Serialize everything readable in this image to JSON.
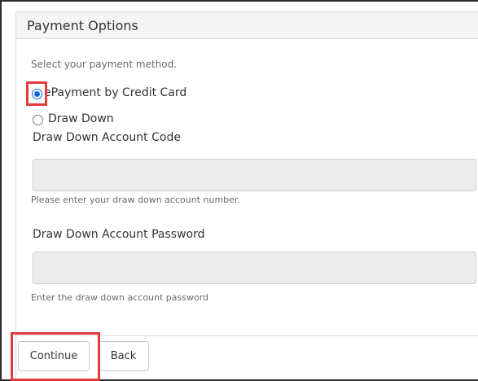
{
  "panel": {
    "title": "Payment Options",
    "instruction": "Select your payment method."
  },
  "payment_methods": [
    {
      "label": "ePayment by Credit Card",
      "selected": true
    },
    {
      "label": "Draw Down",
      "selected": false
    }
  ],
  "fields": {
    "account_code": {
      "label": "Draw Down Account Code",
      "value": "",
      "help": "Please enter your draw down account number."
    },
    "account_password": {
      "label": "Draw Down Account Password",
      "value": "",
      "help": "Enter the draw down account password"
    }
  },
  "buttons": {
    "continue": "Continue",
    "back": "Back"
  },
  "colors": {
    "highlight": "#e23b3b",
    "radio_selected": "#0a66d8",
    "input_background": "#ececec"
  }
}
